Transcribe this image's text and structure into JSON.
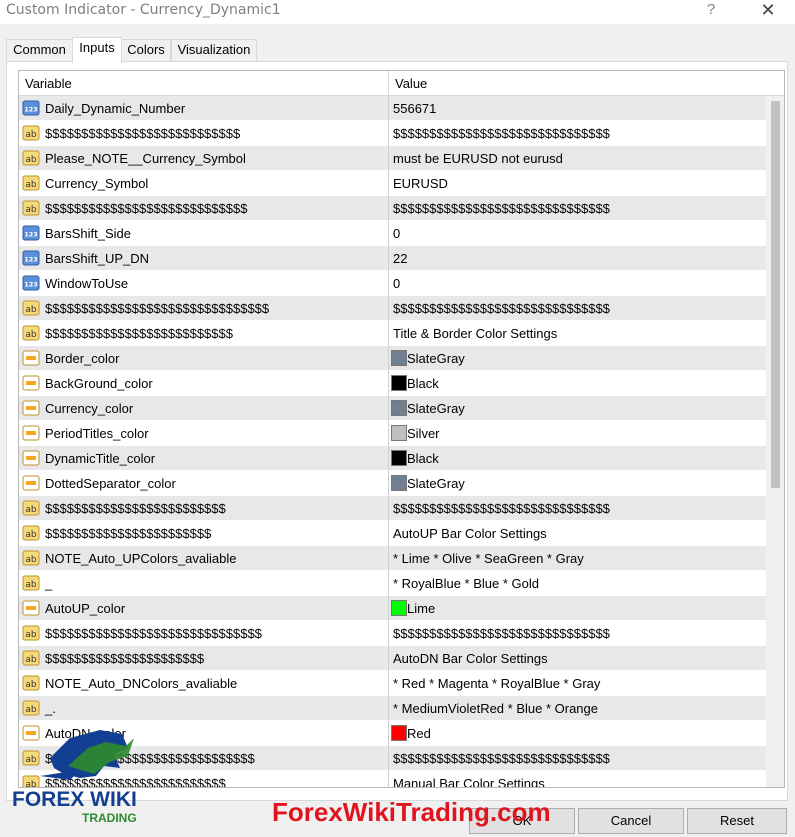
{
  "window": {
    "title": "Custom Indicator - Currency_Dynamic1",
    "help_label": "?",
    "close_label": "✕"
  },
  "tabs": [
    {
      "label": "Common",
      "active": false
    },
    {
      "label": "Inputs",
      "active": true
    },
    {
      "label": "Colors",
      "active": false
    },
    {
      "label": "Visualization",
      "active": false
    }
  ],
  "table": {
    "headers": {
      "variable": "Variable",
      "value": "Value"
    },
    "rows": [
      {
        "icon": "number-icon",
        "variable": "Daily_Dynamic_Number",
        "value": "556671"
      },
      {
        "icon": "string-icon",
        "variable": "$$$$$$$$$$$$$$$$$$$$$$$$$$$",
        "value": "$$$$$$$$$$$$$$$$$$$$$$$$$$$$$$"
      },
      {
        "icon": "string-icon",
        "variable": "Please_NOTE__Currency_Symbol",
        "value": " must be  EURUSD  not  eurusd"
      },
      {
        "icon": "string-icon",
        "variable": "Currency_Symbol",
        "value": "EURUSD"
      },
      {
        "icon": "string-icon",
        "variable": "$$$$$$$$$$$$$$$$$$$$$$$$$$$$",
        "value": "$$$$$$$$$$$$$$$$$$$$$$$$$$$$$$"
      },
      {
        "icon": "number-icon",
        "variable": "BarsShift_Side",
        "value": "0"
      },
      {
        "icon": "number-icon",
        "variable": "BarsShift_UP_DN",
        "value": "22"
      },
      {
        "icon": "number-icon",
        "variable": "WindowToUse",
        "value": "0"
      },
      {
        "icon": "string-icon",
        "variable": "$$$$$$$$$$$$$$$$$$$$$$$$$$$$$$$",
        "value": "$$$$$$$$$$$$$$$$$$$$$$$$$$$$$$"
      },
      {
        "icon": "string-icon",
        "variable": "$$$$$$$$$$$$$$$$$$$$$$$$$$",
        "value": "Title &  Border Color Settings"
      },
      {
        "icon": "color-icon",
        "variable": "Border_color",
        "value": "SlateGray",
        "swatch": "#708090"
      },
      {
        "icon": "color-icon",
        "variable": "BackGround_color",
        "value": "Black",
        "swatch": "#000000"
      },
      {
        "icon": "color-icon",
        "variable": "Currency_color",
        "value": "SlateGray",
        "swatch": "#708090"
      },
      {
        "icon": "color-icon",
        "variable": "PeriodTitles_color",
        "value": "Silver",
        "swatch": "#c0c0c0"
      },
      {
        "icon": "color-icon",
        "variable": "DynamicTitle_color",
        "value": "Black",
        "swatch": "#000000"
      },
      {
        "icon": "color-icon",
        "variable": "DottedSeparator_color",
        "value": "SlateGray",
        "swatch": "#708090"
      },
      {
        "icon": "string-icon",
        "variable": "$$$$$$$$$$$$$$$$$$$$$$$$$",
        "value": "$$$$$$$$$$$$$$$$$$$$$$$$$$$$$$"
      },
      {
        "icon": "string-icon",
        "variable": "$$$$$$$$$$$$$$$$$$$$$$$",
        "value": "AutoUP Bar Color Settings"
      },
      {
        "icon": "string-icon",
        "variable": "NOTE_Auto_UPColors_avaliable",
        "value": "* Lime  * Olive * SeaGreen * Gray"
      },
      {
        "icon": "string-icon",
        "variable": "_",
        "value": "* RoyalBlue * Blue * Gold"
      },
      {
        "icon": "color-icon",
        "variable": "AutoUP_color",
        "value": "Lime",
        "swatch": "#00ff00"
      },
      {
        "icon": "string-icon",
        "variable": "$$$$$$$$$$$$$$$$$$$$$$$$$$$$$$",
        "value": "$$$$$$$$$$$$$$$$$$$$$$$$$$$$$$"
      },
      {
        "icon": "string-icon",
        "variable": "$$$$$$$$$$$$$$$$$$$$$$",
        "value": "AutoDN Bar Color Settings"
      },
      {
        "icon": "string-icon",
        "variable": "NOTE_Auto_DNColors_avaliable",
        "value": "* Red  * Magenta * RoyalBlue * Gray"
      },
      {
        "icon": "string-icon",
        "variable": "_.",
        "value": "* MediumVioletRed * Blue * Orange"
      },
      {
        "icon": "color-icon",
        "variable": "AutoDN_color",
        "value": "Red",
        "swatch": "#ff0000"
      },
      {
        "icon": "string-icon",
        "variable": "$$$$$$$$$$$$$$$$$$$$$$$$$$$$$",
        "value": "$$$$$$$$$$$$$$$$$$$$$$$$$$$$$$"
      },
      {
        "icon": "string-icon",
        "variable": "$$$$$$$$$$$$$$$$$$$$$$$$$",
        "value": "Manual Bar Color Settings"
      }
    ]
  },
  "buttons": {
    "ok": "OK",
    "cancel": "Cancel",
    "reset": "Reset"
  },
  "overlay": {
    "logo_text": "FOREX WIKI",
    "logo_sub": "TRADING",
    "watermark": "ForexWikiTrading.com",
    "colors": {
      "red": "#e0141e",
      "blue": "#123f91",
      "green": "#2e8b2e"
    }
  }
}
